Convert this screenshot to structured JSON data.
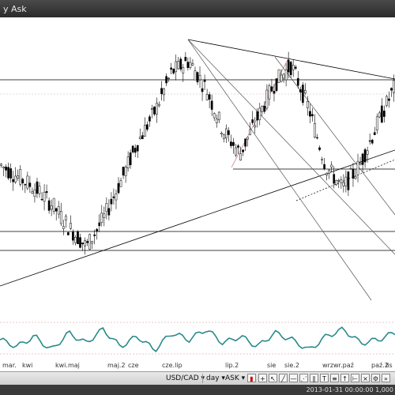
{
  "window": {
    "title": "y Ask"
  },
  "x_axis": {
    "labels": [
      "mar.",
      "kwi",
      "kwi.maj",
      "maj.2",
      "cze",
      "cze.lip",
      "lip.2",
      "sie",
      "sie.2",
      "wrz",
      "wr.paź",
      "paź.2",
      "lis"
    ]
  },
  "toolbar": {
    "symbol": "USD/CAD",
    "timeframe": "day",
    "price_type": "ASK"
  },
  "status": {
    "text": "2013-01-31 00:00:00  1,000"
  },
  "colors": {
    "candle": "#000000",
    "oscillator": "#2a8a8a",
    "accent_line": "#d09090"
  },
  "chart_data": [
    {
      "type": "candlestick",
      "title": "",
      "categories": [
        "mar",
        "kwi",
        "maj",
        "cze",
        "lip",
        "sie",
        "wrz",
        "paź",
        "lis"
      ],
      "series": [
        {
          "values": [
            0.995,
            0.99,
            0.985,
            0.978,
            0.968,
            0.96,
            0.972,
            0.988,
            1.005,
            1.018,
            1.035,
            1.04,
            1.028,
            1.01,
            1.0,
            1.015,
            1.03,
            1.038,
            1.02,
            0.995,
            0.985,
            0.995,
            1.012,
            1.028
          ]
        }
      ],
      "grid": false
    },
    {
      "type": "line",
      "title": "",
      "series": [
        {
          "values": [
            0.5,
            0.3,
            0.6,
            0.2,
            0.7,
            0.4,
            0.8,
            0.3,
            0.6,
            0.2,
            0.7,
            0.5,
            0.8,
            0.4,
            0.6,
            0.3,
            0.7,
            0.5,
            0.2,
            0.6,
            0.8,
            0.4,
            0.5,
            0.7
          ]
        }
      ]
    }
  ]
}
